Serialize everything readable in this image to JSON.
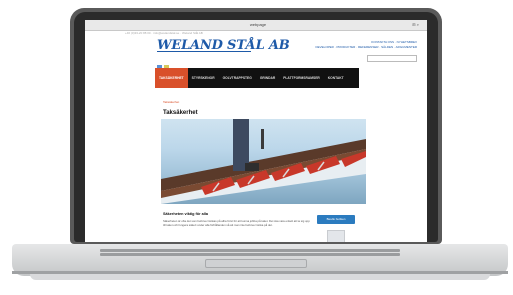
{
  "browser": {
    "url": "webpage",
    "toolbar_right": "⊞ ⌕",
    "faint_header": "+46 (0)33-20 88 00 · info@welandstal.se · Weland Stål AB"
  },
  "site": {
    "logo": "WELAND STÅL AB",
    "top_links": [
      "KONTAKTA OSS · NYHETSBREV",
      "DEVELOPER · PRODUKTER · REFERENSER · SÅLDEN · ARGUMENTER"
    ],
    "nav": [
      "TAKSÄKERHET",
      "STYRSKENOR",
      "GOLVTRAPPSTEG",
      "GRINDAR",
      "PLATTFORMSRAMSER",
      "KONTAKT"
    ],
    "breadcrumb": "Taksäkerhet",
    "page_title": "Taksäkerhet",
    "section_title": "Säkerheten viktig för alla",
    "section_text": "Säkerheten är ofta det som behöver tänkas på allra först för att kunna jobba på taket. Det ska vara enkelt att ta sig upp till taket och fungera säkert under alla förhållanden så att man inte behöver tänka på det.",
    "cta_button": "Besök butiken"
  },
  "colors": {
    "brand_blue": "#1e5aa8",
    "nav_active": "#d9502a",
    "nav_bg": "#111111",
    "cta": "#2b7bbf"
  }
}
